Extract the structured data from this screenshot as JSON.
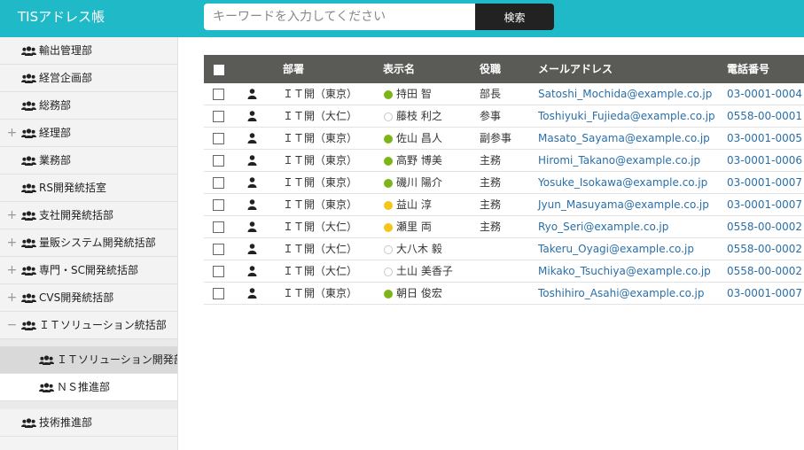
{
  "header": {
    "title": "TISアドレス帳",
    "search_placeholder": "キーワードを入力してください",
    "search_button": "検索"
  },
  "sidebar": {
    "items": [
      {
        "label": "輸出管理部",
        "toggle": ""
      },
      {
        "label": "経営企画部",
        "toggle": ""
      },
      {
        "label": "総務部",
        "toggle": ""
      },
      {
        "label": "経理部",
        "toggle": "+"
      },
      {
        "label": "業務部",
        "toggle": ""
      },
      {
        "label": "RS開発統括室",
        "toggle": ""
      },
      {
        "label": "支社開発統括部",
        "toggle": "+"
      },
      {
        "label": "量販システム開発統括部",
        "toggle": "+"
      },
      {
        "label": "専門・SC開発統括部",
        "toggle": "+"
      },
      {
        "label": "CVS開発統括部",
        "toggle": "+"
      },
      {
        "label": "ＩＴソリューション統括部",
        "toggle": "−"
      }
    ],
    "sub_items": [
      {
        "label": "ＩＴソリューション開発部"
      },
      {
        "label": "ＮＳ推進部"
      }
    ],
    "bottom_items": [
      {
        "label": "技術推進部"
      }
    ]
  },
  "table": {
    "headers": {
      "department": "部署",
      "display_name": "表示名",
      "position": "役職",
      "email": "メールアドレス",
      "phone": "電話番号"
    },
    "status_colors": {
      "online": "#7cb518",
      "away": "#f5c518",
      "offline": "#ffffff"
    },
    "rows": [
      {
        "department": "ＩＴ開（東京）",
        "status": "online",
        "name": "持田 智",
        "position": "部長",
        "email": "Satoshi_Mochida@example.co.jp",
        "phone": "03-0001-0004"
      },
      {
        "department": "ＩＴ開（大仁）",
        "status": "offline",
        "name": "藤枝 利之",
        "position": "参事",
        "email": "Toshiyuki_Fujieda@example.co.jp",
        "phone": "0558-00-0001"
      },
      {
        "department": "ＩＴ開（東京）",
        "status": "online",
        "name": "佐山 昌人",
        "position": "副参事",
        "email": "Masato_Sayama@example.co.jp",
        "phone": "03-0001-0005"
      },
      {
        "department": "ＩＴ開（東京）",
        "status": "online",
        "name": "高野 博美",
        "position": "主務",
        "email": "Hiromi_Takano@example.co.jp",
        "phone": "03-0001-0006"
      },
      {
        "department": "ＩＴ開（東京）",
        "status": "online",
        "name": "磯川 陽介",
        "position": "主務",
        "email": "Yosuke_Isokawa@example.co.jp",
        "phone": "03-0001-0007"
      },
      {
        "department": "ＩＴ開（東京）",
        "status": "away",
        "name": "益山 淳",
        "position": "主務",
        "email": "Jyun_Masuyama@example.co.jp",
        "phone": "03-0001-0007"
      },
      {
        "department": "ＩＴ開（大仁）",
        "status": "away",
        "name": "瀬里 両",
        "position": "主務",
        "email": "Ryo_Seri@example.co.jp",
        "phone": "0558-00-0002"
      },
      {
        "department": "ＩＴ開（大仁）",
        "status": "offline",
        "name": "大八木 毅",
        "position": "",
        "email": "Takeru_Oyagi@example.co.jp",
        "phone": "0558-00-0002"
      },
      {
        "department": "ＩＴ開（大仁）",
        "status": "offline",
        "name": "土山 美香子",
        "position": "",
        "email": "Mikako_Tsuchiya@example.co.jp",
        "phone": "0558-00-0002"
      },
      {
        "department": "ＩＴ開（東京）",
        "status": "online",
        "name": "朝日 俊宏",
        "position": "",
        "email": "Toshihiro_Asahi@example.co.jp",
        "phone": "03-0001-0007"
      }
    ]
  }
}
